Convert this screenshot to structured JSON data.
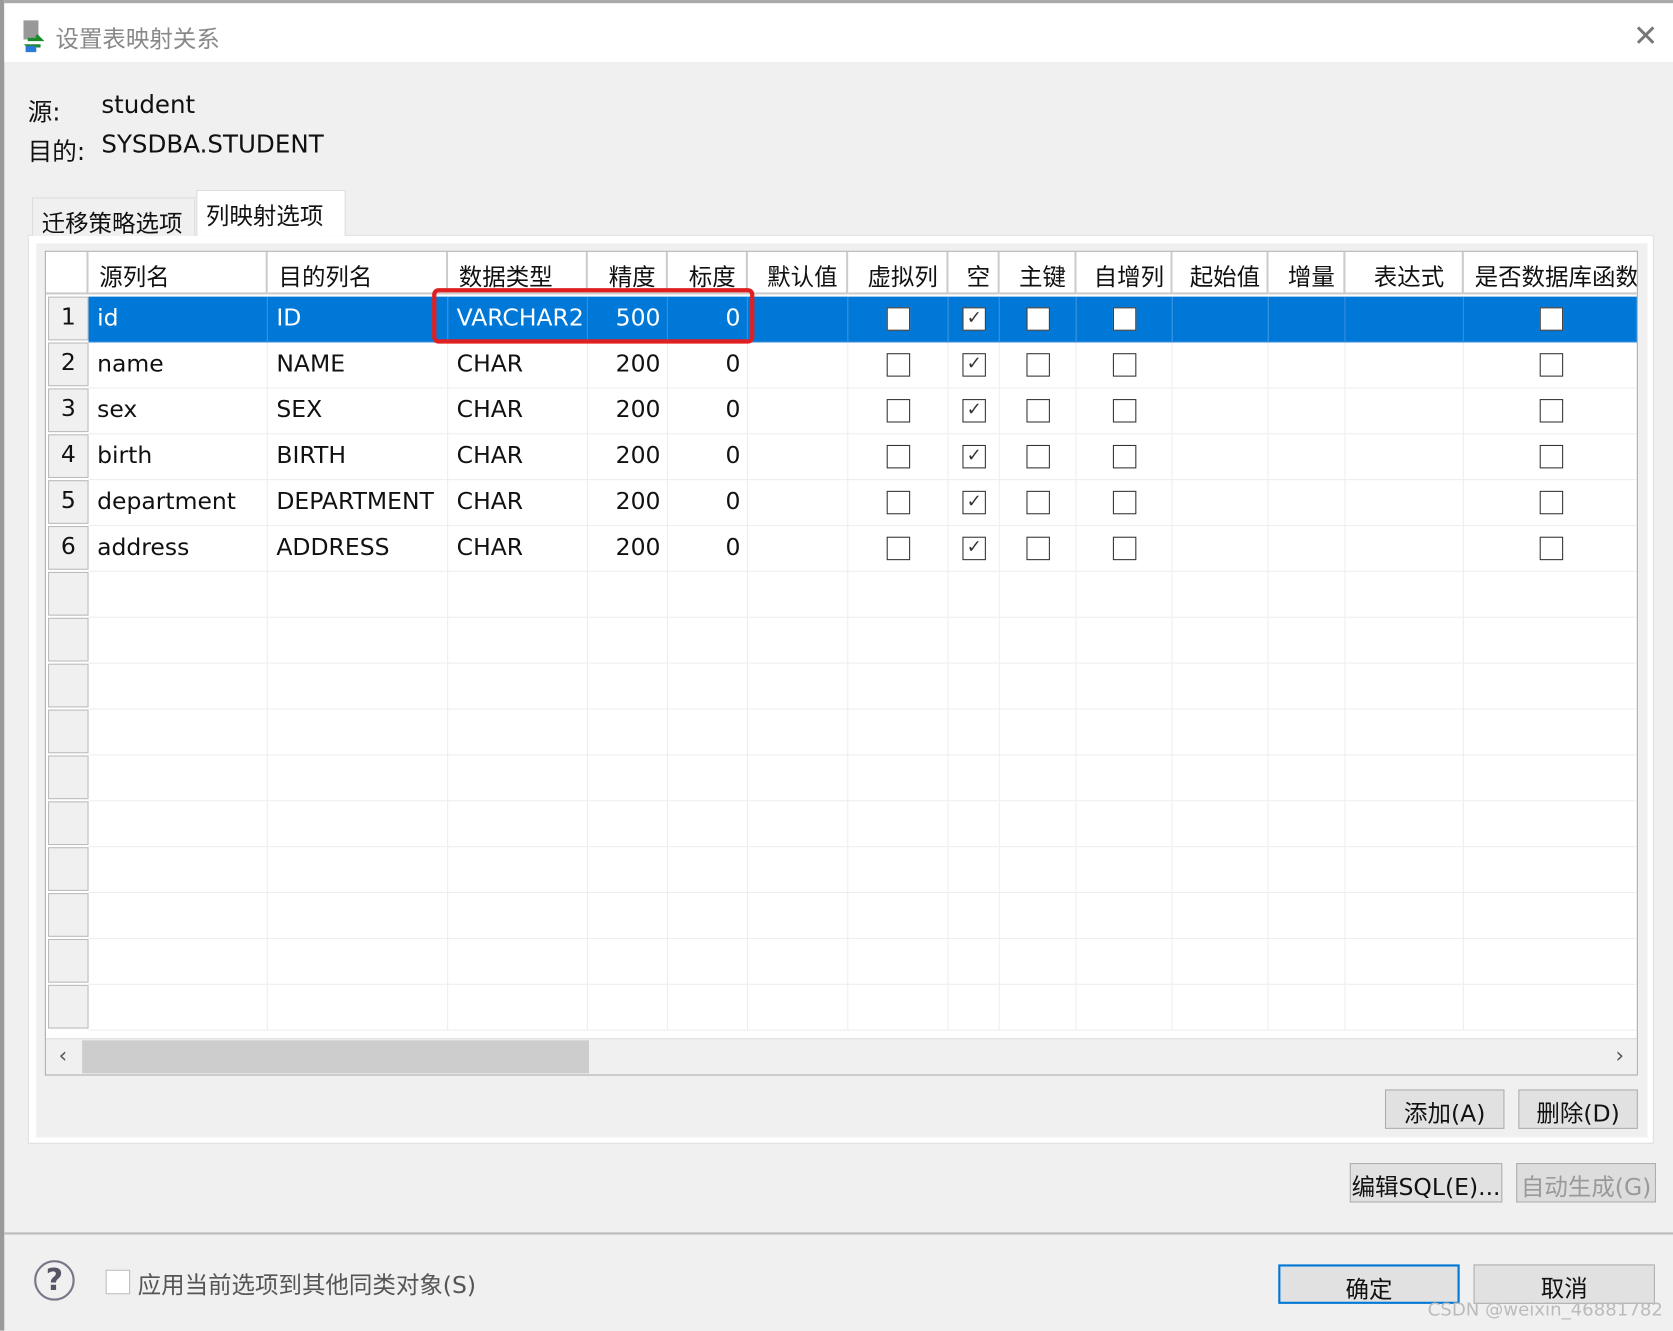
{
  "window": {
    "title": "设置表映射关系",
    "close_icon": "close-icon"
  },
  "source": {
    "label": "源:",
    "value": "student"
  },
  "target": {
    "label": "目的:",
    "value": "SYSDBA.STUDENT"
  },
  "tabs": [
    {
      "label": "迁移策略选项",
      "active": false
    },
    {
      "label": "列映射选项",
      "active": true
    }
  ],
  "table": {
    "headers": [
      "源列名",
      "目的列名",
      "数据类型",
      "精度",
      "标度",
      "默认值",
      "虚拟列",
      "空",
      "主键",
      "自增列",
      "起始值",
      "增量",
      "表达式",
      "是否数据库函数"
    ],
    "rows": [
      {
        "n": "1",
        "src": "id",
        "dst": "ID",
        "type": "VARCHAR2",
        "prec": "500",
        "scale": "0",
        "virtual": false,
        "null": true,
        "pk": false,
        "auto": false,
        "dbfunc": false,
        "selected": true
      },
      {
        "n": "2",
        "src": "name",
        "dst": "NAME",
        "type": "CHAR",
        "prec": "200",
        "scale": "0",
        "virtual": false,
        "null": true,
        "pk": false,
        "auto": false,
        "dbfunc": false
      },
      {
        "n": "3",
        "src": "sex",
        "dst": "SEX",
        "type": "CHAR",
        "prec": "200",
        "scale": "0",
        "virtual": false,
        "null": true,
        "pk": false,
        "auto": false,
        "dbfunc": false
      },
      {
        "n": "4",
        "src": "birth",
        "dst": "BIRTH",
        "type": "CHAR",
        "prec": "200",
        "scale": "0",
        "virtual": false,
        "null": true,
        "pk": false,
        "auto": false,
        "dbfunc": false
      },
      {
        "n": "5",
        "src": "department",
        "dst": "DEPARTMENT",
        "type": "CHAR",
        "prec": "200",
        "scale": "0",
        "virtual": false,
        "null": true,
        "pk": false,
        "auto": false,
        "dbfunc": false
      },
      {
        "n": "6",
        "src": "address",
        "dst": "ADDRESS",
        "type": "CHAR",
        "prec": "200",
        "scale": "0",
        "virtual": false,
        "null": true,
        "pk": false,
        "auto": false,
        "dbfunc": false
      }
    ],
    "highlight_color": "#e02020",
    "selection_color": "#0078d7"
  },
  "buttons": {
    "add": "添加(A)",
    "delete": "删除(D)",
    "edit_sql": "编辑SQL(E)...",
    "auto_gen": "自动生成(G)",
    "ok": "确定",
    "cancel": "取消"
  },
  "footer": {
    "apply_label": "应用当前选项到其他同类对象(S)",
    "apply_checked": false,
    "help_icon": "help-icon"
  },
  "watermark": "CSDN @weixin_46881782"
}
